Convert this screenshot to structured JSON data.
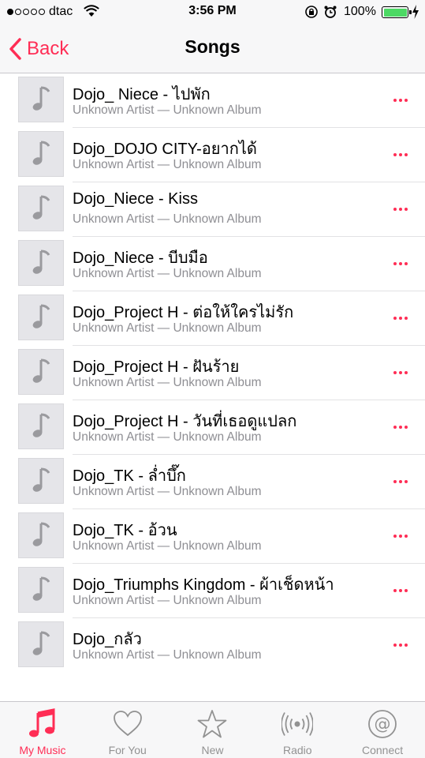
{
  "status_bar": {
    "carrier": "dtac",
    "time": "3:56 PM",
    "battery_percent": "100%",
    "signal_bars": 1,
    "signal_total": 5
  },
  "nav": {
    "back_label": "Back",
    "title": "Songs"
  },
  "songs": [
    {
      "title": "Dojo_ Niece - ไปพัก",
      "subtitle": "Unknown Artist — Unknown Album"
    },
    {
      "title": "Dojo_DOJO CITY-อยากได้",
      "subtitle": "Unknown Artist — Unknown Album"
    },
    {
      "title": "Dojo_Niece - Kiss",
      "subtitle": "Unknown Artist — Unknown Album"
    },
    {
      "title": "Dojo_Niece - บีบมือ",
      "subtitle": "Unknown Artist — Unknown Album"
    },
    {
      "title": "Dojo_Project H - ต่อให้ใครไม่รัก",
      "subtitle": "Unknown Artist — Unknown Album"
    },
    {
      "title": "Dojo_Project H - ฝันร้าย",
      "subtitle": "Unknown Artist — Unknown Album"
    },
    {
      "title": "Dojo_Project H - วันที่เธอดูแปลก",
      "subtitle": "Unknown Artist — Unknown Album"
    },
    {
      "title": "Dojo_TK - ล่ำบึ๊ก",
      "subtitle": "Unknown Artist — Unknown Album"
    },
    {
      "title": "Dojo_TK - อ้วน",
      "subtitle": "Unknown Artist — Unknown Album"
    },
    {
      "title": "Dojo_Triumphs Kingdom - ผ้าเช็ดหน้า",
      "subtitle": "Unknown Artist — Unknown Album"
    },
    {
      "title": "Dojo_กลัว",
      "subtitle": "Unknown Artist — Unknown Album"
    }
  ],
  "tabs": [
    {
      "label": "My Music",
      "icon": "music-note-icon",
      "active": true
    },
    {
      "label": "For You",
      "icon": "heart-icon",
      "active": false
    },
    {
      "label": "New",
      "icon": "star-icon",
      "active": false
    },
    {
      "label": "Radio",
      "icon": "radio-icon",
      "active": false
    },
    {
      "label": "Connect",
      "icon": "at-sign-icon",
      "active": false
    }
  ],
  "colors": {
    "accent": "#ff2d55",
    "secondary_text": "#8e8e93",
    "inactive_tab": "#929292",
    "battery": "#4cd964",
    "artwork_bg": "#e5e5e9"
  }
}
